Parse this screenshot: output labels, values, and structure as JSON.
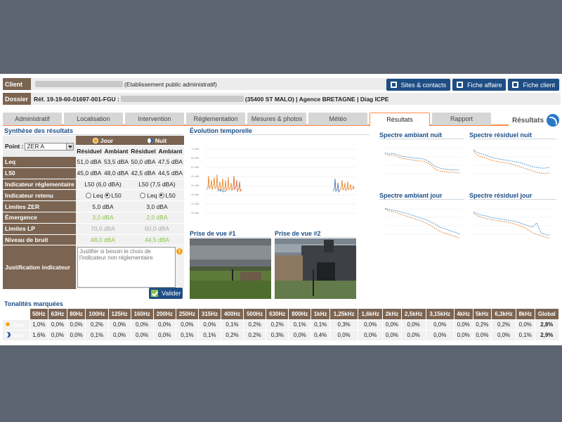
{
  "header": {
    "client_label": "Client",
    "client_type": "(Etablissement public administratif)",
    "dossier_label": "Dossier",
    "dossier_ref": "Réf. 19-19-60-01697-001-FGU :",
    "dossier_location": "(35400 ST MALO) | Agence BRETAGNE | Diag ICPE",
    "buttons": [
      "Sites & contacts",
      "Fiche affaire",
      "Fiche client"
    ]
  },
  "tabs": [
    "Administratif",
    "Localisation",
    "Intervention",
    "Réglementation",
    "Mesures & photos",
    "Météo",
    "Résultats",
    "Rapport"
  ],
  "active_tab": "Résultats",
  "tab_right_label": "Résultats",
  "synthesis": {
    "title": "Synthèse des résultats",
    "point_label": "Point :",
    "point_value": "ZER A",
    "jour": "Jour",
    "nuit": "Nuit",
    "residuel": "Résiduel",
    "ambiant": "Ambiant",
    "rows": {
      "leq": {
        "label": "Leq",
        "v": [
          "51,0 dBA",
          "53,5 dBA",
          "50,0 dBA",
          "47,5 dBA"
        ]
      },
      "l50": {
        "label": "L50",
        "v": [
          "45,0 dBA",
          "48,0 dBA",
          "42,5 dBA",
          "44,5 dBA"
        ]
      },
      "indic_regl": {
        "label": "Indicateur réglementaire",
        "jour": "L50 (6,0 dBA)",
        "nuit": "L50 (7,5 dBA)"
      },
      "indic_ret": {
        "label": "Indicateur retenu",
        "opt1": "Leq",
        "opt2": "L50"
      },
      "limites_zer": {
        "label": "Limites ZER",
        "jour": "5,0 dBA",
        "nuit": "3,0 dBA"
      },
      "emergence": {
        "label": "Émergence",
        "jour": "3,0 dBA",
        "nuit": "2,0 dBA"
      },
      "limites_lp": {
        "label": "Limites LP",
        "jour": "70,0 dBA",
        "nuit": "60,0 dBA"
      },
      "niveau_bruit": {
        "label": "Niveau de bruit",
        "jour": "48,0 dBA",
        "nuit": "44,5 dBA"
      },
      "justification": {
        "label": "Justification indicateur",
        "placeholder": "Justifier si besoin le choix de l'indicateur non réglementaire"
      }
    },
    "valider": "Valider"
  },
  "evolution": {
    "title": "Évolution temporelle"
  },
  "photos": {
    "p1": "Prise de vue #1",
    "p2": "Prise de vue #2"
  },
  "spectres": {
    "amb_nuit": "Spectre ambiant nuit",
    "res_nuit": "Spectre résiduel nuit",
    "amb_jour": "Spectre ambiant jour",
    "res_jour": "Spectre résiduel jour"
  },
  "tonalites": {
    "title": "Tonalités marquées",
    "freqs": [
      "50Hz",
      "63Hz",
      "80Hz",
      "100Hz",
      "125Hz",
      "160Hz",
      "200Hz",
      "250Hz",
      "315Hz",
      "400Hz",
      "500Hz",
      "630Hz",
      "800Hz",
      "1kHz",
      "1,25kHz",
      "1,6kHz",
      "2kHz",
      "2,5kHz",
      "3,15kHz",
      "4kHz",
      "5kHz",
      "6,3kHz",
      "8kHz",
      "Global"
    ],
    "jour_label": "Jour",
    "nuit_label": "Nuit",
    "jour": [
      "1,0%",
      "0,0%",
      "0,0%",
      "0,2%",
      "0,0%",
      "0,0%",
      "0,0%",
      "0,0%",
      "0,0%",
      "0,1%",
      "0,2%",
      "0,2%",
      "0,1%",
      "0,1%",
      "0,3%",
      "0,0%",
      "0,0%",
      "0,0%",
      "0,0%",
      "0,0%",
      "0,2%",
      "0,2%",
      "0,0%",
      "2,8%"
    ],
    "nuit": [
      "1,6%",
      "0,0%",
      "0,0%",
      "0,1%",
      "0,0%",
      "0,0%",
      "0,0%",
      "0,1%",
      "0,1%",
      "0,2%",
      "0,2%",
      "0,3%",
      "0,0%",
      "0,4%",
      "0,0%",
      "0,0%",
      "0,0%",
      "0,0%",
      "0,0%",
      "0,0%",
      "0,0%",
      "0,0%",
      "0,1%",
      "2,9%"
    ]
  },
  "colors": {
    "brown": "#7b6451",
    "navy": "#1f4e85",
    "orange": "#ff8b4a",
    "green": "#8cc24a",
    "title_blue": "#1e4e86"
  }
}
